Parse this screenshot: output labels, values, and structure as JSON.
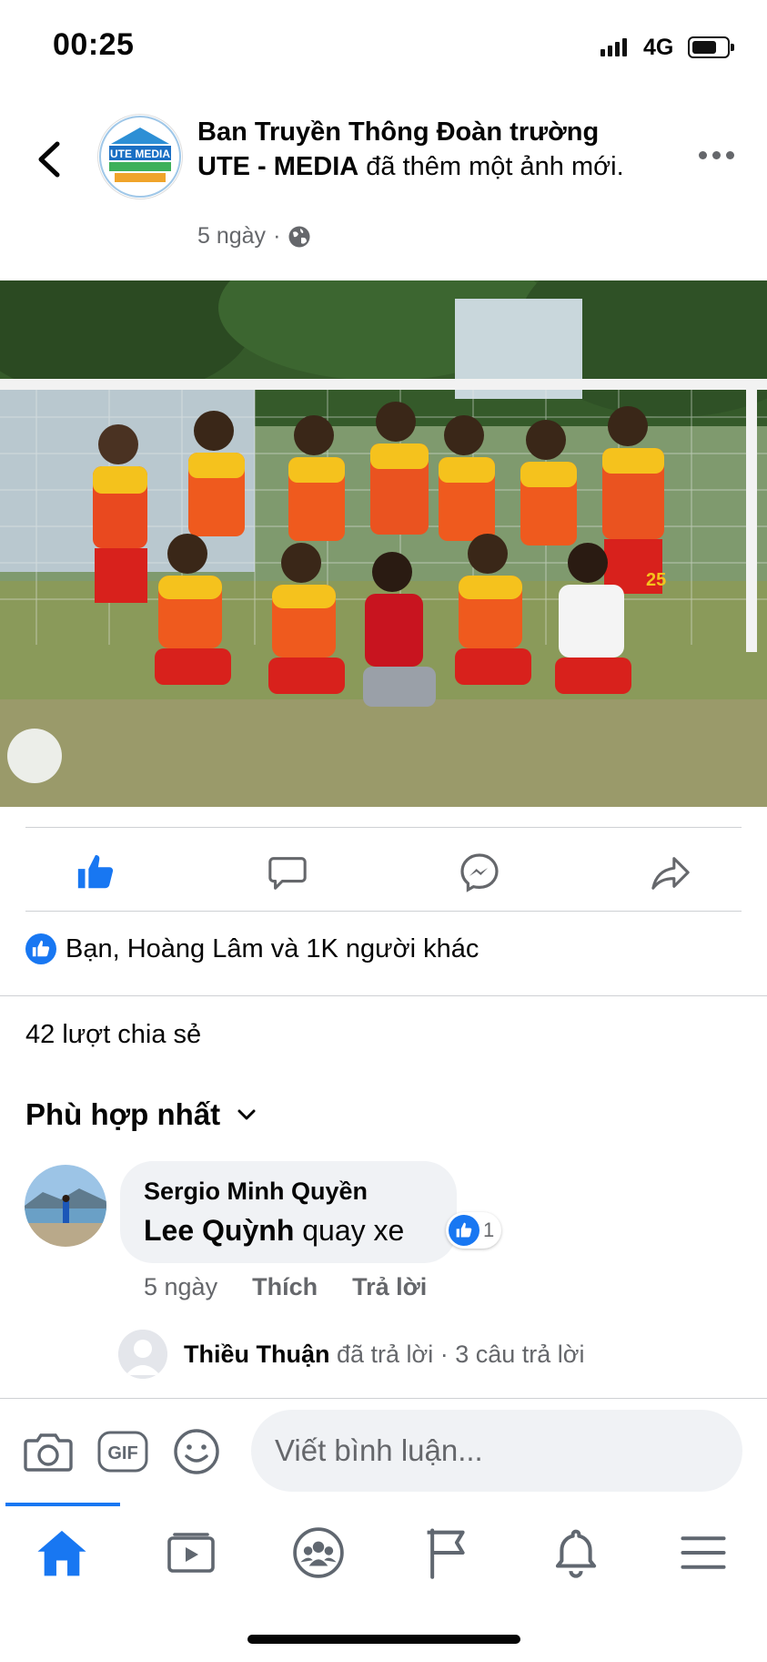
{
  "status_bar": {
    "time": "00:25",
    "network": "4G"
  },
  "post": {
    "page_name": "Ban Truyền Thông Đoàn trường UTE - MEDIA",
    "action_text": "đã thêm một ảnh mới.",
    "time": "5 ngày",
    "separator": "·",
    "photo_jersey_number": "25"
  },
  "reactions": {
    "summary": "Bạn, Hoàng Lâm và 1K người khác"
  },
  "shares": {
    "text": "42 lượt chia sẻ"
  },
  "sort": {
    "label": "Phù hợp nhất"
  },
  "comment": {
    "author": "Sergio Minh Quyền",
    "mention": "Lee Quỳnh",
    "text": "quay xe",
    "like_count": "1",
    "time": "5 ngày",
    "like_action": "Thích",
    "reply_action": "Trả lời"
  },
  "reply_summary": {
    "author": "Thiều Thuận",
    "text": "đã trả lời · 3 câu trả lời"
  },
  "composer": {
    "placeholder": "Viết bình luận...",
    "gif_label": "GIF"
  },
  "page_logo_text": "UTE MEDIA",
  "colors": {
    "accent": "#1877f2",
    "secondary_text": "#65676b",
    "bubble_bg": "#f0f2f5"
  }
}
